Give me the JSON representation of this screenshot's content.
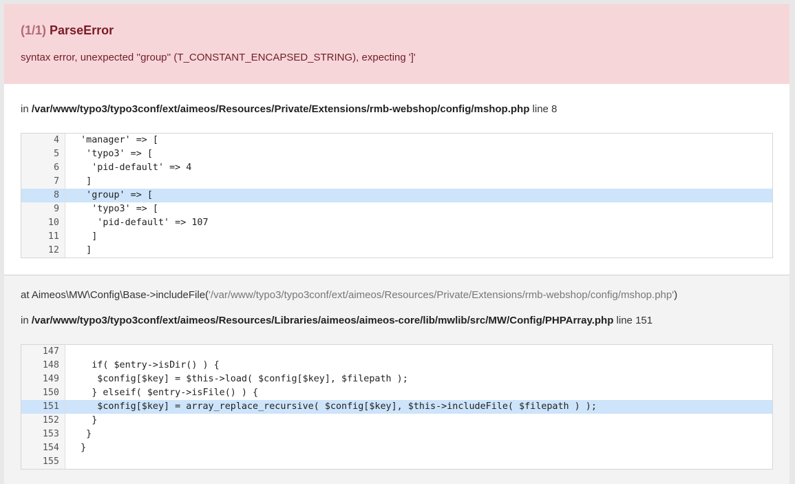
{
  "header": {
    "count": "(1/1)",
    "error_type": "ParseError",
    "message": "syntax error, unexpected ''group'' (T_CONSTANT_ENCAPSED_STRING), expecting ']'"
  },
  "frame1": {
    "in_label": "in",
    "file": "/var/www/typo3/typo3conf/ext/aimeos/Resources/Private/Extensions/rmb-webshop/config/mshop.php",
    "line_label": "line 8",
    "code": [
      {
        "n": "4",
        "src": "  'manager' => [",
        "hl": false
      },
      {
        "n": "5",
        "src": "   'typo3' => [",
        "hl": false
      },
      {
        "n": "6",
        "src": "    'pid-default' => 4",
        "hl": false
      },
      {
        "n": "7",
        "src": "   ]",
        "hl": false
      },
      {
        "n": "8",
        "src": "   'group' => [",
        "hl": true
      },
      {
        "n": "9",
        "src": "    'typo3' => [",
        "hl": false
      },
      {
        "n": "10",
        "src": "     'pid-default' => 107",
        "hl": false
      },
      {
        "n": "11",
        "src": "    ]",
        "hl": false
      },
      {
        "n": "12",
        "src": "   ]",
        "hl": false
      }
    ]
  },
  "frame2": {
    "at_text": "at Aimeos\\MW\\Config\\Base->includeFile(",
    "at_arg": "'/var/www/typo3/typo3conf/ext/aimeos/Resources/Private/Extensions/rmb-webshop/config/mshop.php'",
    "at_close": ")",
    "in_label": "in",
    "file": "/var/www/typo3/typo3conf/ext/aimeos/Resources/Libraries/aimeos/aimeos-core/lib/mwlib/src/MW/Config/PHPArray.php",
    "line_label": "line 151",
    "code": [
      {
        "n": "147",
        "src": "",
        "hl": false
      },
      {
        "n": "148",
        "src": "    if( $entry->isDir() ) {",
        "hl": false
      },
      {
        "n": "149",
        "src": "     $config[$key] = $this->load( $config[$key], $filepath );",
        "hl": false
      },
      {
        "n": "150",
        "src": "    } elseif( $entry->isFile() ) {",
        "hl": false
      },
      {
        "n": "151",
        "src": "     $config[$key] = array_replace_recursive( $config[$key], $this->includeFile( $filepath ) );",
        "hl": true
      },
      {
        "n": "152",
        "src": "    }",
        "hl": false
      },
      {
        "n": "153",
        "src": "   }",
        "hl": false
      },
      {
        "n": "154",
        "src": "  }",
        "hl": false
      },
      {
        "n": "155",
        "src": "",
        "hl": false
      }
    ]
  }
}
